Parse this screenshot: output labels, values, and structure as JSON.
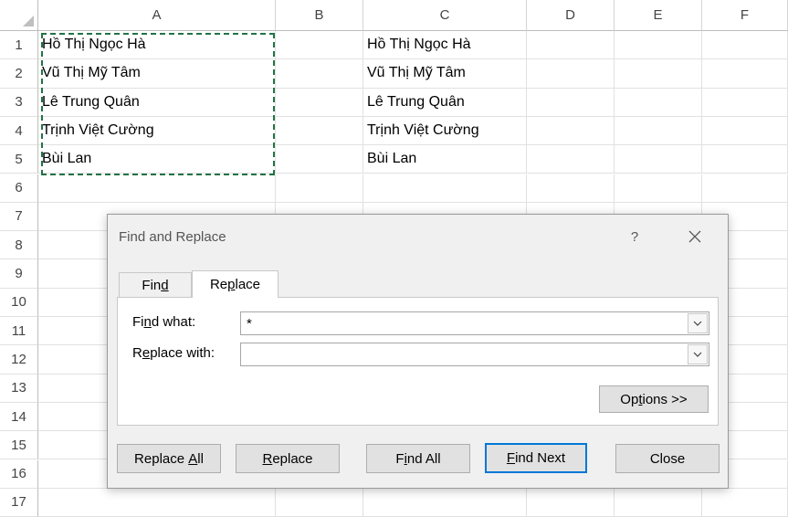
{
  "columns": [
    "A",
    "B",
    "C",
    "D",
    "E",
    "F"
  ],
  "rows": [
    "1",
    "2",
    "3",
    "4",
    "5",
    "6",
    "7",
    "8",
    "9",
    "10",
    "11",
    "12",
    "13",
    "14",
    "15",
    "16",
    "17"
  ],
  "cells": {
    "A": [
      "Hồ Thị Ngọc Hà",
      "Vũ Thị Mỹ Tâm",
      "Lê Trung Quân",
      "Trịnh Việt Cường",
      "Bùi Lan"
    ],
    "C": [
      "Hồ Thị Ngọc Hà",
      "Vũ Thị Mỹ Tâm",
      "Lê Trung Quân",
      "Trịnh Việt Cường",
      "Bùi Lan"
    ]
  },
  "colors": {
    "marquee": "#217346",
    "accent": "#0078d7"
  },
  "dialog": {
    "title": "Find and Replace",
    "help": "?",
    "close_icon": "close-icon",
    "tabs": [
      {
        "pre": "Fin",
        "ul": "d",
        "post": ""
      },
      {
        "pre": "Re",
        "ul": "p",
        "post": "lace"
      }
    ],
    "find_label": {
      "pre": "Fi",
      "ul": "n",
      "post": "d what:"
    },
    "find_value": "*",
    "replace_label": {
      "pre": "R",
      "ul": "e",
      "post": "place with:"
    },
    "replace_value": "",
    "options": {
      "pre": "Op",
      "ul": "t",
      "post": "ions >>"
    },
    "buttons": {
      "replace_all": {
        "pre": "Replace ",
        "ul": "A",
        "post": "ll"
      },
      "replace": {
        "pre": "",
        "ul": "R",
        "post": "eplace"
      },
      "find_all": {
        "pre": "F",
        "ul": "i",
        "post": "nd All"
      },
      "find_next": {
        "pre": "",
        "ul": "F",
        "post": "ind Next"
      },
      "close": {
        "pre": "Close",
        "ul": "",
        "post": ""
      }
    }
  }
}
